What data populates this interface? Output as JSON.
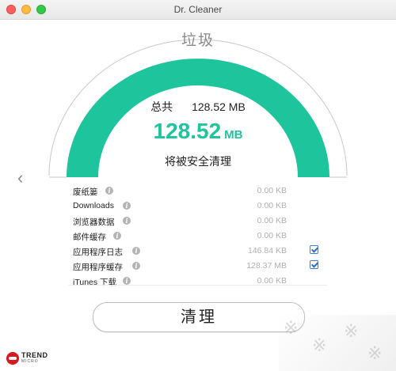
{
  "window": {
    "title": "Dr. Cleaner"
  },
  "gauge": {
    "label": "垃圾",
    "total_label": "总共",
    "total_value": "128.52 MB",
    "big_number": "128.52",
    "big_unit": "MB",
    "status_text": "将被安全清理",
    "fill_fraction": 1.0,
    "accent_color": "#1ec49b"
  },
  "nav": {
    "left_arrow": "‹"
  },
  "items": [
    {
      "name": "废纸篓",
      "size": "0.00 KB",
      "checked": null
    },
    {
      "name": "Downloads",
      "size": "0.00 KB",
      "checked": null
    },
    {
      "name": "浏览器数据",
      "size": "0.00 KB",
      "checked": null
    },
    {
      "name": "邮件缓存",
      "size": "0.00 KB",
      "checked": null
    },
    {
      "name": "应用程序日志",
      "size": "146.84 KB",
      "checked": true
    },
    {
      "name": "应用程序缓存",
      "size": "128.37 MB",
      "checked": true
    },
    {
      "name": "iTunes 下载",
      "size": "0.00 KB",
      "checked": null
    }
  ],
  "actions": {
    "clean_label": "清理"
  },
  "brand": {
    "name": "TREND",
    "sub": "MICRO",
    "color": "#d71920"
  }
}
